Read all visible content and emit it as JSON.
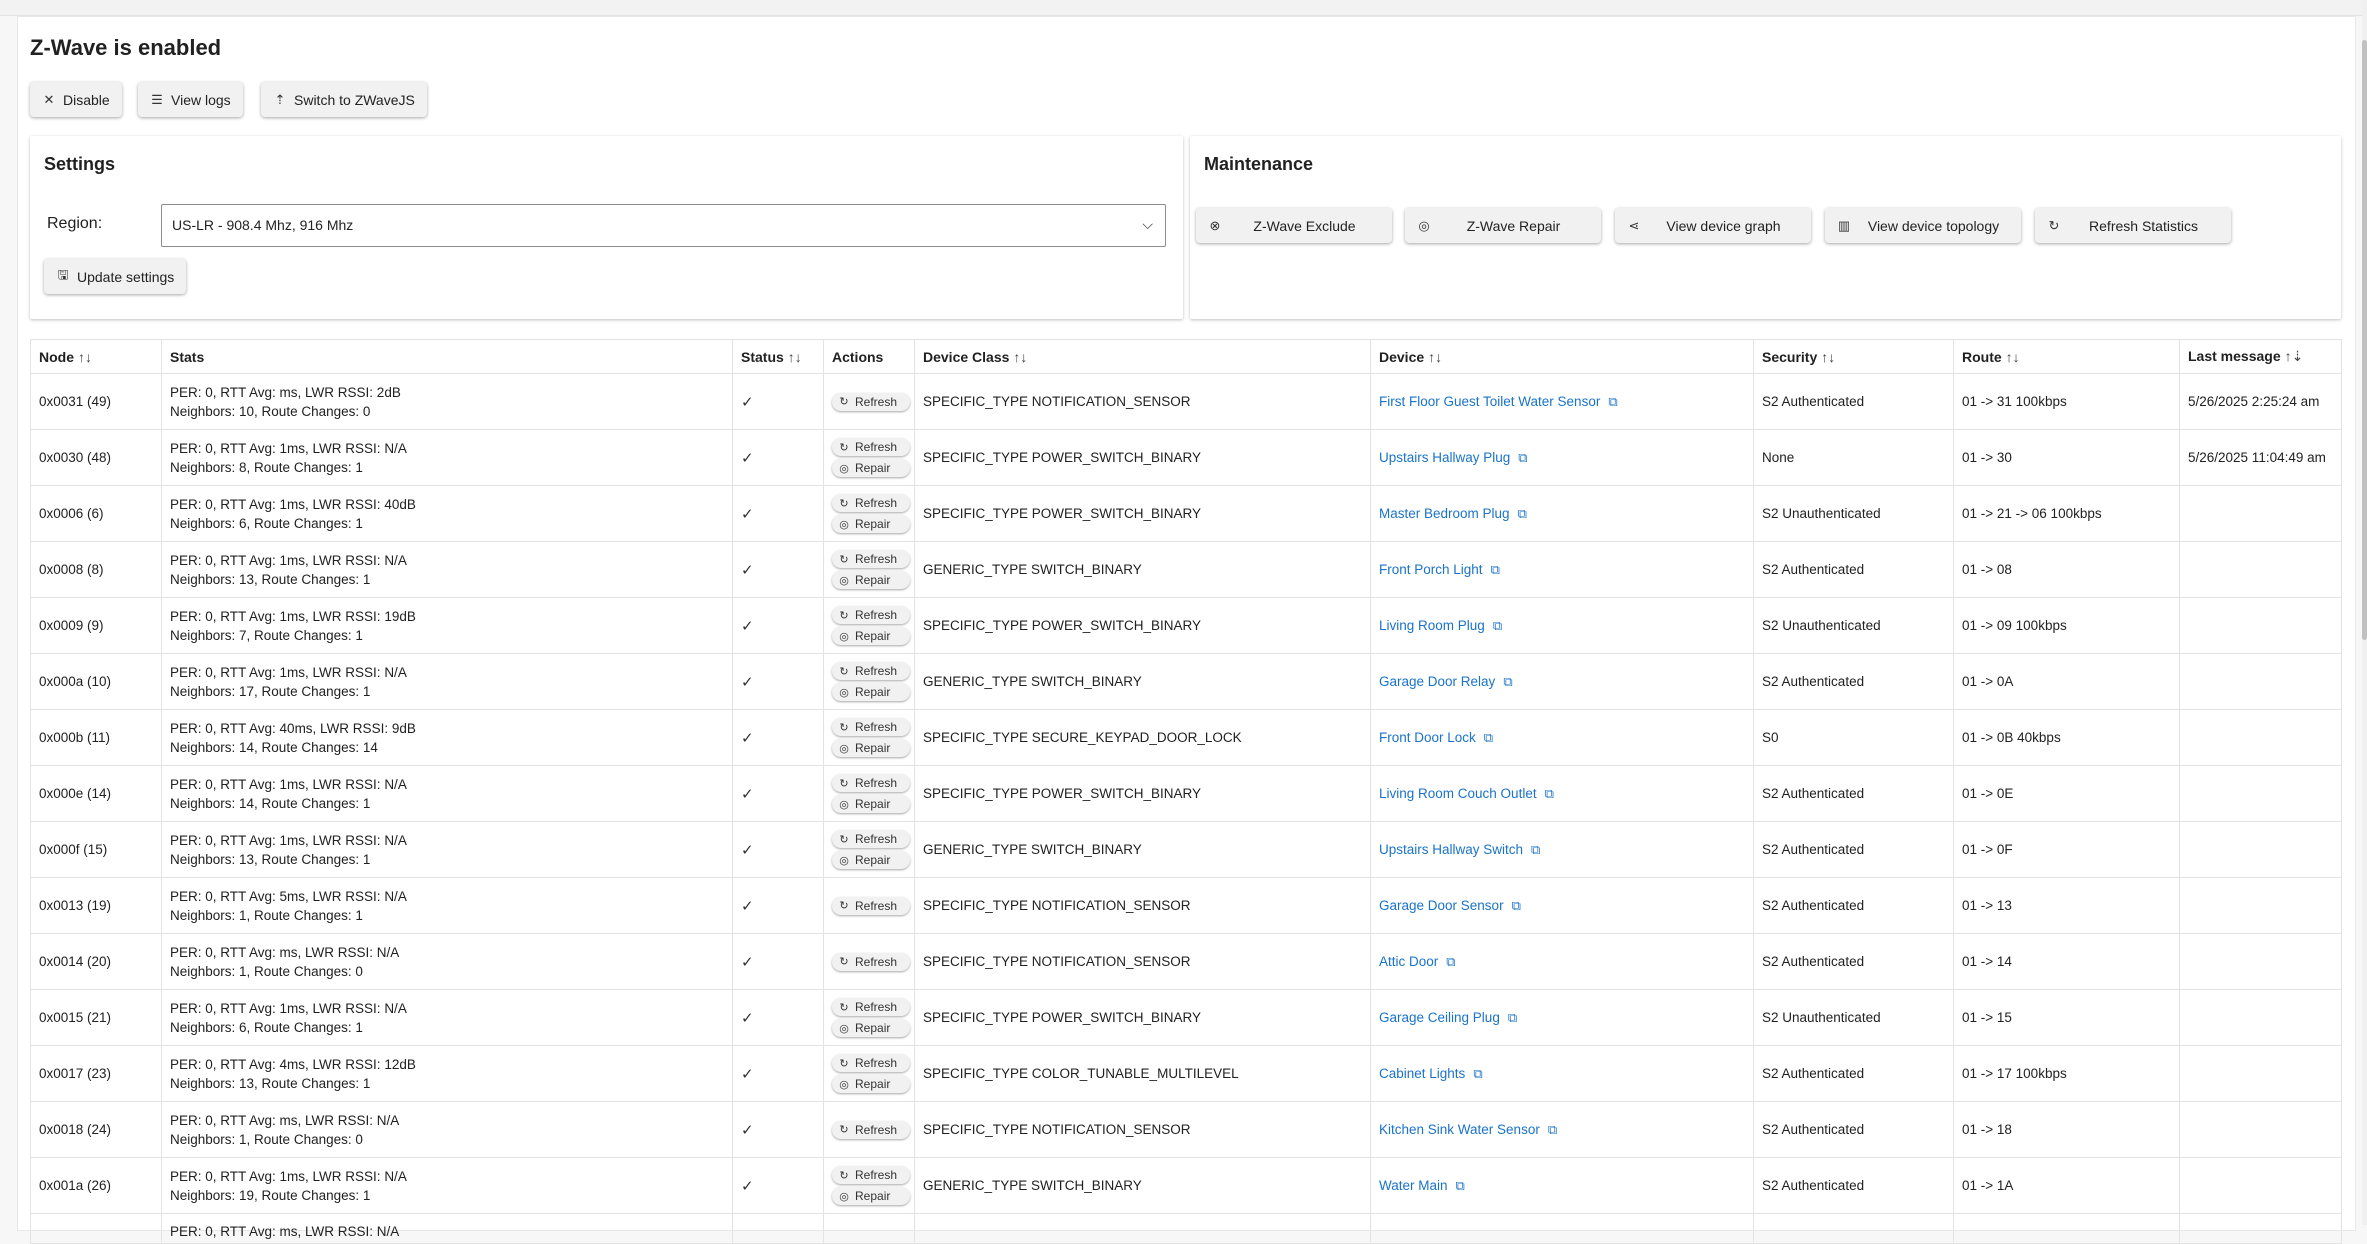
{
  "page": {
    "title": "Z-Wave is enabled"
  },
  "toolbar": {
    "disable_label": "Disable",
    "view_logs_label": "View logs",
    "switch_label": "Switch to ZWaveJS"
  },
  "settings": {
    "title": "Settings",
    "region_label": "Region:",
    "region_value": "US-LR - 908.4 Mhz, 916 Mhz",
    "update_label": "Update settings"
  },
  "maintenance": {
    "title": "Maintenance",
    "buttons": [
      {
        "label": "Z-Wave Exclude",
        "icon": "circle-x-icon"
      },
      {
        "label": "Z-Wave Repair",
        "icon": "repair-icon"
      },
      {
        "label": "View device graph",
        "icon": "share-icon"
      },
      {
        "label": "View device topology",
        "icon": "map-icon"
      },
      {
        "label": "Refresh Statistics",
        "icon": "refresh-icon"
      }
    ]
  },
  "table": {
    "headers": {
      "node": "Node",
      "stats": "Stats",
      "status": "Status",
      "actions": "Actions",
      "device_class": "Device Class",
      "device": "Device",
      "security": "Security",
      "route": "Route",
      "last_message": "Last message"
    },
    "refresh_label": "Refresh",
    "repair_label": "Repair",
    "status_check": "✓",
    "rows": [
      {
        "node": "0x0031 (49)",
        "stats1": "PER: 0, RTT Avg: ms, LWR RSSI: 2dB",
        "stats2": "Neighbors: 10, Route Changes: 0",
        "device_class": "SPECIFIC_TYPE NOTIFICATION_SENSOR",
        "device": "First Floor Guest Toilet Water Sensor",
        "security": "S2 Authenticated",
        "route": "01 -> 31 100kbps",
        "last_message": "5/26/2025 2:25:24 am",
        "repair": false
      },
      {
        "node": "0x0030 (48)",
        "stats1": "PER: 0, RTT Avg: 1ms, LWR RSSI: N/A",
        "stats2": "Neighbors: 8, Route Changes: 1",
        "device_class": "SPECIFIC_TYPE POWER_SWITCH_BINARY",
        "device": "Upstairs Hallway Plug",
        "security": "None",
        "route": "01 -> 30",
        "last_message": "5/26/2025 11:04:49 am",
        "repair": true
      },
      {
        "node": "0x0006 (6)",
        "stats1": "PER: 0, RTT Avg: 1ms, LWR RSSI: 40dB",
        "stats2": "Neighbors: 6, Route Changes: 1",
        "device_class": "SPECIFIC_TYPE POWER_SWITCH_BINARY",
        "device": "Master Bedroom Plug",
        "security": "S2 Unauthenticated",
        "route": "01 -> 21 -> 06 100kbps",
        "last_message": "",
        "repair": true
      },
      {
        "node": "0x0008 (8)",
        "stats1": "PER: 0, RTT Avg: 1ms, LWR RSSI: N/A",
        "stats2": "Neighbors: 13, Route Changes: 1",
        "device_class": "GENERIC_TYPE SWITCH_BINARY",
        "device": "Front Porch Light",
        "security": "S2 Authenticated",
        "route": "01 -> 08",
        "last_message": "",
        "repair": true
      },
      {
        "node": "0x0009 (9)",
        "stats1": "PER: 0, RTT Avg: 1ms, LWR RSSI: 19dB",
        "stats2": "Neighbors: 7, Route Changes: 1",
        "device_class": "SPECIFIC_TYPE POWER_SWITCH_BINARY",
        "device": "Living Room Plug",
        "security": "S2 Unauthenticated",
        "route": "01 -> 09 100kbps",
        "last_message": "",
        "repair": true
      },
      {
        "node": "0x000a (10)",
        "stats1": "PER: 0, RTT Avg: 1ms, LWR RSSI: N/A",
        "stats2": "Neighbors: 17, Route Changes: 1",
        "device_class": "GENERIC_TYPE SWITCH_BINARY",
        "device": "Garage Door Relay",
        "security": "S2 Authenticated",
        "route": "01 -> 0A",
        "last_message": "",
        "repair": true
      },
      {
        "node": "0x000b (11)",
        "stats1": "PER: 0, RTT Avg: 40ms, LWR RSSI: 9dB",
        "stats2": "Neighbors: 14, Route Changes: 14",
        "device_class": "SPECIFIC_TYPE SECURE_KEYPAD_DOOR_LOCK",
        "device": "Front Door Lock",
        "security": "S0",
        "route": "01 -> 0B 40kbps",
        "last_message": "",
        "repair": true
      },
      {
        "node": "0x000e (14)",
        "stats1": "PER: 0, RTT Avg: 1ms, LWR RSSI: N/A",
        "stats2": "Neighbors: 14, Route Changes: 1",
        "device_class": "SPECIFIC_TYPE POWER_SWITCH_BINARY",
        "device": "Living Room Couch Outlet",
        "security": "S2 Authenticated",
        "route": "01 -> 0E",
        "last_message": "",
        "repair": true
      },
      {
        "node": "0x000f (15)",
        "stats1": "PER: 0, RTT Avg: 1ms, LWR RSSI: N/A",
        "stats2": "Neighbors: 13, Route Changes: 1",
        "device_class": "GENERIC_TYPE SWITCH_BINARY",
        "device": "Upstairs Hallway Switch",
        "security": "S2 Authenticated",
        "route": "01 -> 0F",
        "last_message": "",
        "repair": true
      },
      {
        "node": "0x0013 (19)",
        "stats1": "PER: 0, RTT Avg: 5ms, LWR RSSI: N/A",
        "stats2": "Neighbors: 1, Route Changes: 1",
        "device_class": "SPECIFIC_TYPE NOTIFICATION_SENSOR",
        "device": "Garage Door Sensor",
        "security": "S2 Authenticated",
        "route": "01 -> 13",
        "last_message": "",
        "repair": false
      },
      {
        "node": "0x0014 (20)",
        "stats1": "PER: 0, RTT Avg: ms, LWR RSSI: N/A",
        "stats2": "Neighbors: 1, Route Changes: 0",
        "device_class": "SPECIFIC_TYPE NOTIFICATION_SENSOR",
        "device": "Attic Door",
        "security": "S2 Authenticated",
        "route": "01 -> 14",
        "last_message": "",
        "repair": false
      },
      {
        "node": "0x0015 (21)",
        "stats1": "PER: 0, RTT Avg: 1ms, LWR RSSI: N/A",
        "stats2": "Neighbors: 6, Route Changes: 1",
        "device_class": "SPECIFIC_TYPE POWER_SWITCH_BINARY",
        "device": "Garage Ceiling Plug",
        "security": "S2 Unauthenticated",
        "route": "01 -> 15",
        "last_message": "",
        "repair": true
      },
      {
        "node": "0x0017 (23)",
        "stats1": "PER: 0, RTT Avg: 4ms, LWR RSSI: 12dB",
        "stats2": "Neighbors: 13, Route Changes: 1",
        "device_class": "SPECIFIC_TYPE COLOR_TUNABLE_MULTILEVEL",
        "device": "Cabinet Lights",
        "security": "S2 Authenticated",
        "route": "01 -> 17 100kbps",
        "last_message": "",
        "repair": true
      },
      {
        "node": "0x0018 (24)",
        "stats1": "PER: 0, RTT Avg: ms, LWR RSSI: N/A",
        "stats2": "Neighbors: 1, Route Changes: 0",
        "device_class": "SPECIFIC_TYPE NOTIFICATION_SENSOR",
        "device": "Kitchen Sink Water Sensor",
        "security": "S2 Authenticated",
        "route": "01 -> 18",
        "last_message": "",
        "repair": false
      },
      {
        "node": "0x001a (26)",
        "stats1": "PER: 0, RTT Avg: 1ms, LWR RSSI: N/A",
        "stats2": "Neighbors: 19, Route Changes: 1",
        "device_class": "GENERIC_TYPE SWITCH_BINARY",
        "device": "Water Main",
        "security": "S2 Authenticated",
        "route": "01 -> 1A",
        "last_message": "",
        "repair": true
      }
    ],
    "partial_row_stats": "PER: 0, RTT Avg: ms, LWR RSSI: N/A"
  },
  "colors": {
    "link": "#1a73c8",
    "button_bg": "#f1f1f1",
    "border": "#e3e3e3"
  }
}
